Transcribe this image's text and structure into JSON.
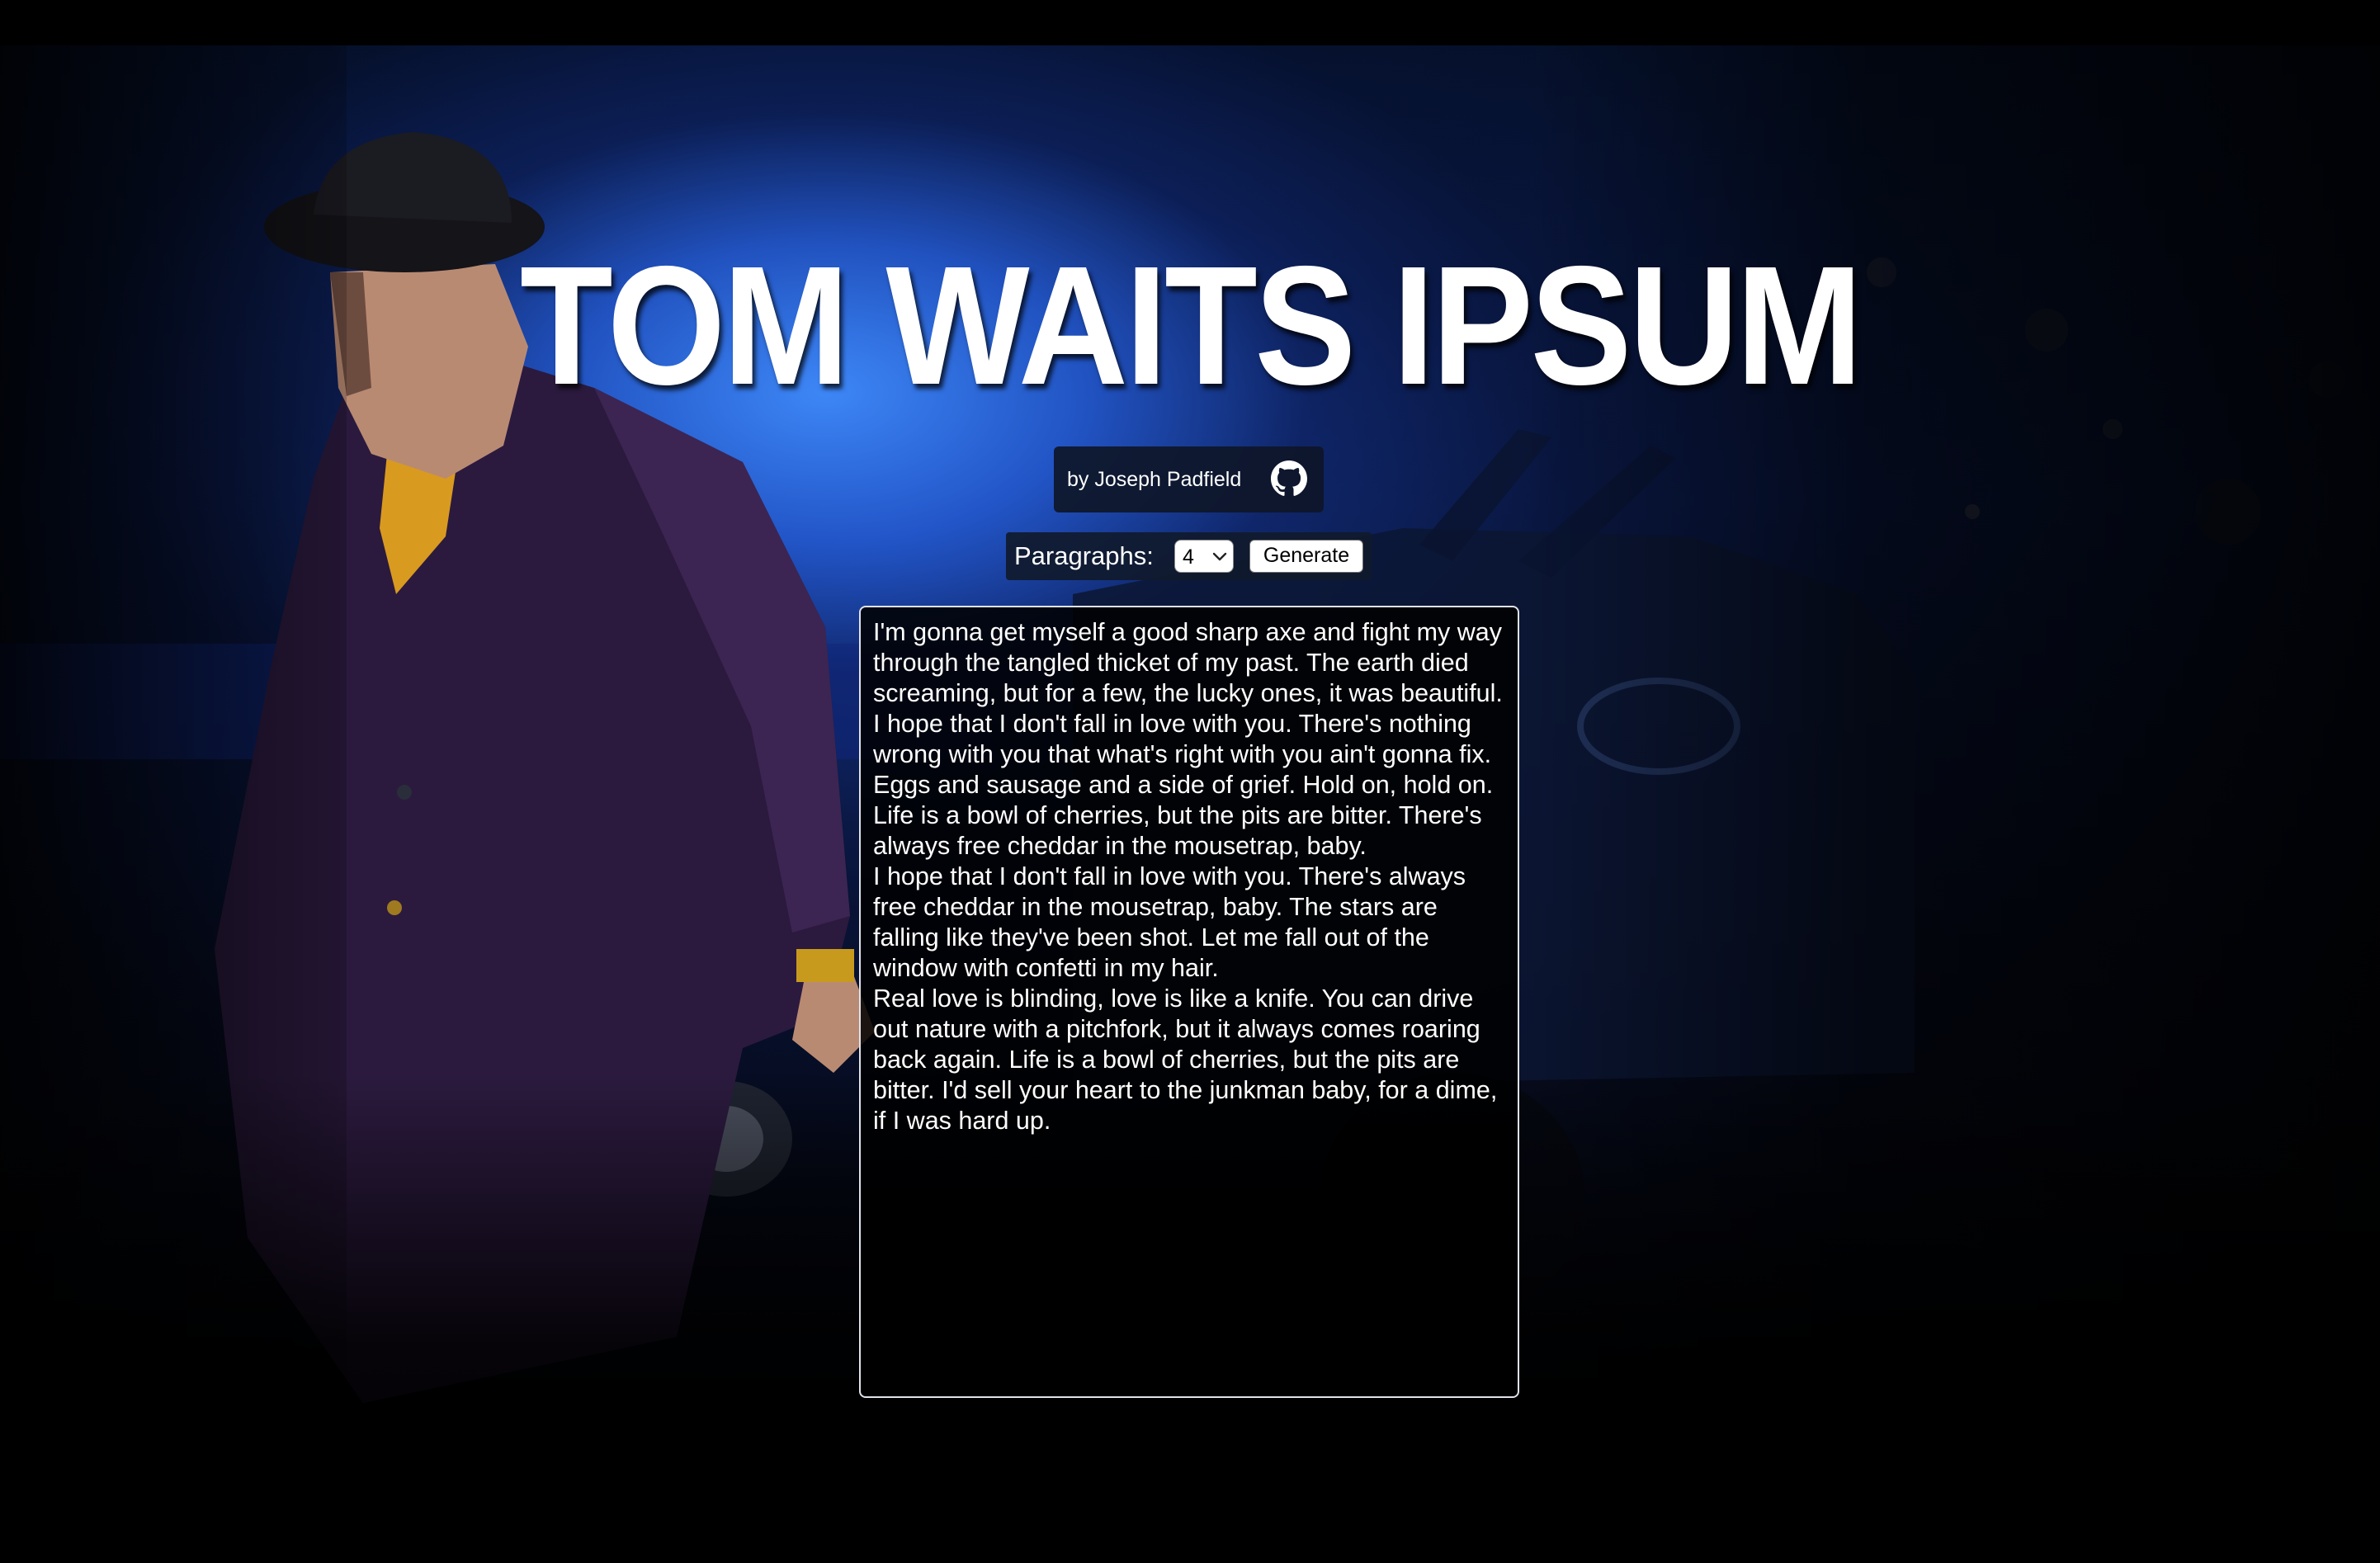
{
  "header": {
    "title": "TOM WAITS IPSUM"
  },
  "author": {
    "byline": "by Joseph Padfield",
    "link_icon": "github-icon"
  },
  "controls": {
    "label": "Paragraphs:",
    "selected_count": "4",
    "generate_label": "Generate"
  },
  "output": {
    "paragraphs": [
      "I'm gonna get myself a good sharp axe and fight my way through the tangled thicket of my past. The earth died screaming, but for a few, the lucky ones, it was beautiful. I hope that I don't fall in love with you. There's nothing wrong with you that what's right with you ain't gonna fix.",
      "Eggs and sausage and a side of grief. Hold on, hold on. Life is a bowl of cherries, but the pits are bitter. There's always free cheddar in the mousetrap, baby.",
      "I hope that I don't fall in love with you. There's always free cheddar in the mousetrap, baby. The stars are falling like they've been shot. Let me fall out of the window with confetti in my hair.",
      "Real love is blinding, love is like a knife. You can drive out nature with a pitchfork, but it always comes roaring back again. Life is a bowl of cherries, but the pits are bitter. I'd sell your heart to the junkman baby, for a dime, if I was hard up."
    ]
  },
  "colors": {
    "background": "#000000",
    "sky_blue": "#3f8cff",
    "panel": "#0e1628",
    "text": "#ffffff"
  }
}
